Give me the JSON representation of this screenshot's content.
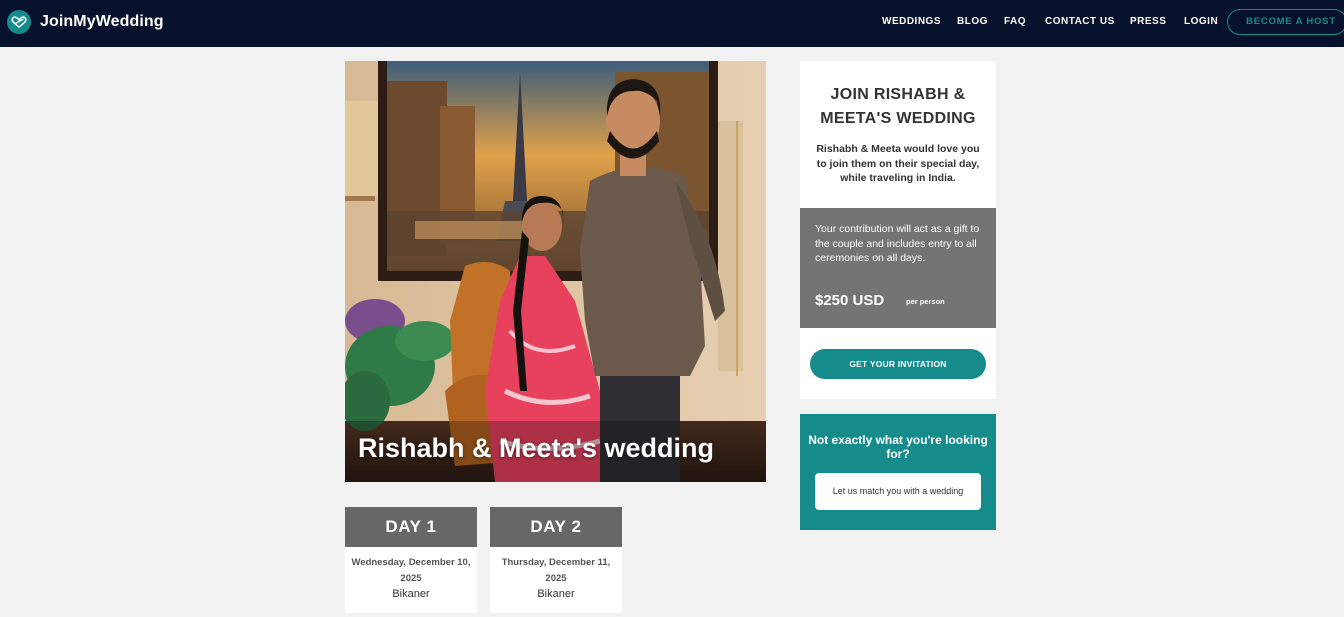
{
  "nav": {
    "logo_text": "JoinMyWedding",
    "links": [
      "WEDDINGS",
      "BLOG",
      "FAQ",
      "CONTACT US",
      "PRESS",
      "LOGIN"
    ],
    "host_button": "BECOME A HOST"
  },
  "hero": {
    "title": "Rishabh & Meeta's wedding"
  },
  "days": [
    {
      "label": "DAY 1",
      "date": "Wednesday, December 10, 2025",
      "place": "Bikaner"
    },
    {
      "label": "DAY 2",
      "date": "Thursday, December 11, 2025",
      "place": "Bikaner"
    }
  ],
  "sidebar": {
    "title": "JOIN RISHABH & MEETA'S WEDDING",
    "intro": "Rishabh & Meeta would love you to join them on their special day, while traveling in India.",
    "contribution_text": "Your contribution will act as a gift to the couple and includes entry to all ceremonies on all days.",
    "price": "$250 USD",
    "price_unit": "per person",
    "invite_button": "GET YOUR INVITATION"
  },
  "match_card": {
    "title": "Not exactly what you're looking for?",
    "button": "Let us match you with a wedding"
  },
  "colors": {
    "nav_bg": "#06112b",
    "accent": "#168b8c",
    "gray_panel": "#747474",
    "day_header": "#676767",
    "page_bg": "#f2f2f2"
  },
  "icons": [
    "interlocked-hearts-logo-icon"
  ]
}
